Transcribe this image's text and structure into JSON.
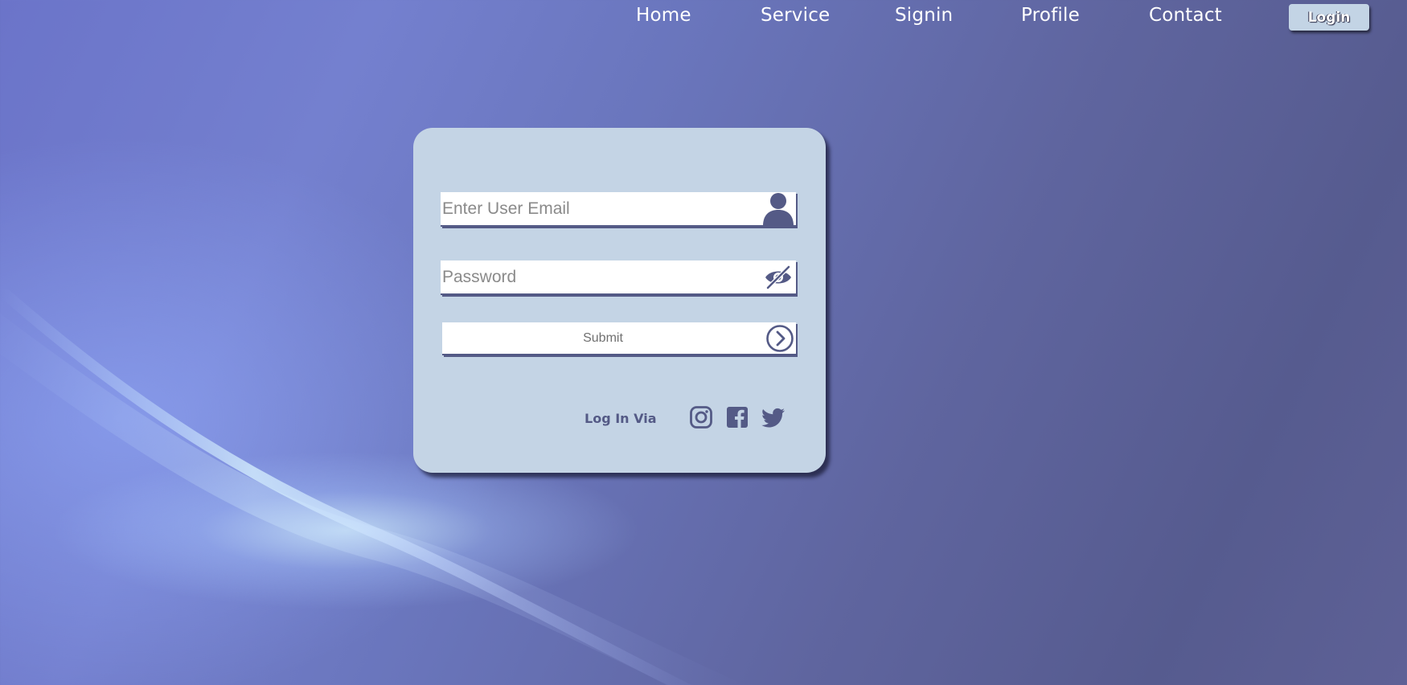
{
  "nav": {
    "links": [
      "Home",
      "Service",
      "Signin",
      "Profile",
      "Contact"
    ],
    "login_button": "Login"
  },
  "form": {
    "email_placeholder": "Enter User Email",
    "password_placeholder": "Password",
    "submit_label": "Submit",
    "login_via_label": "Log In Via"
  },
  "icons": {
    "email": "user-icon",
    "password": "eye-slash-icon",
    "submit": "chevron-right-circle-icon",
    "social": [
      "instagram-icon",
      "facebook-icon",
      "twitter-icon"
    ]
  },
  "colors": {
    "card_background": "#c4d4e5",
    "accent": "#545a86",
    "login_button": "#c3d4e5"
  }
}
